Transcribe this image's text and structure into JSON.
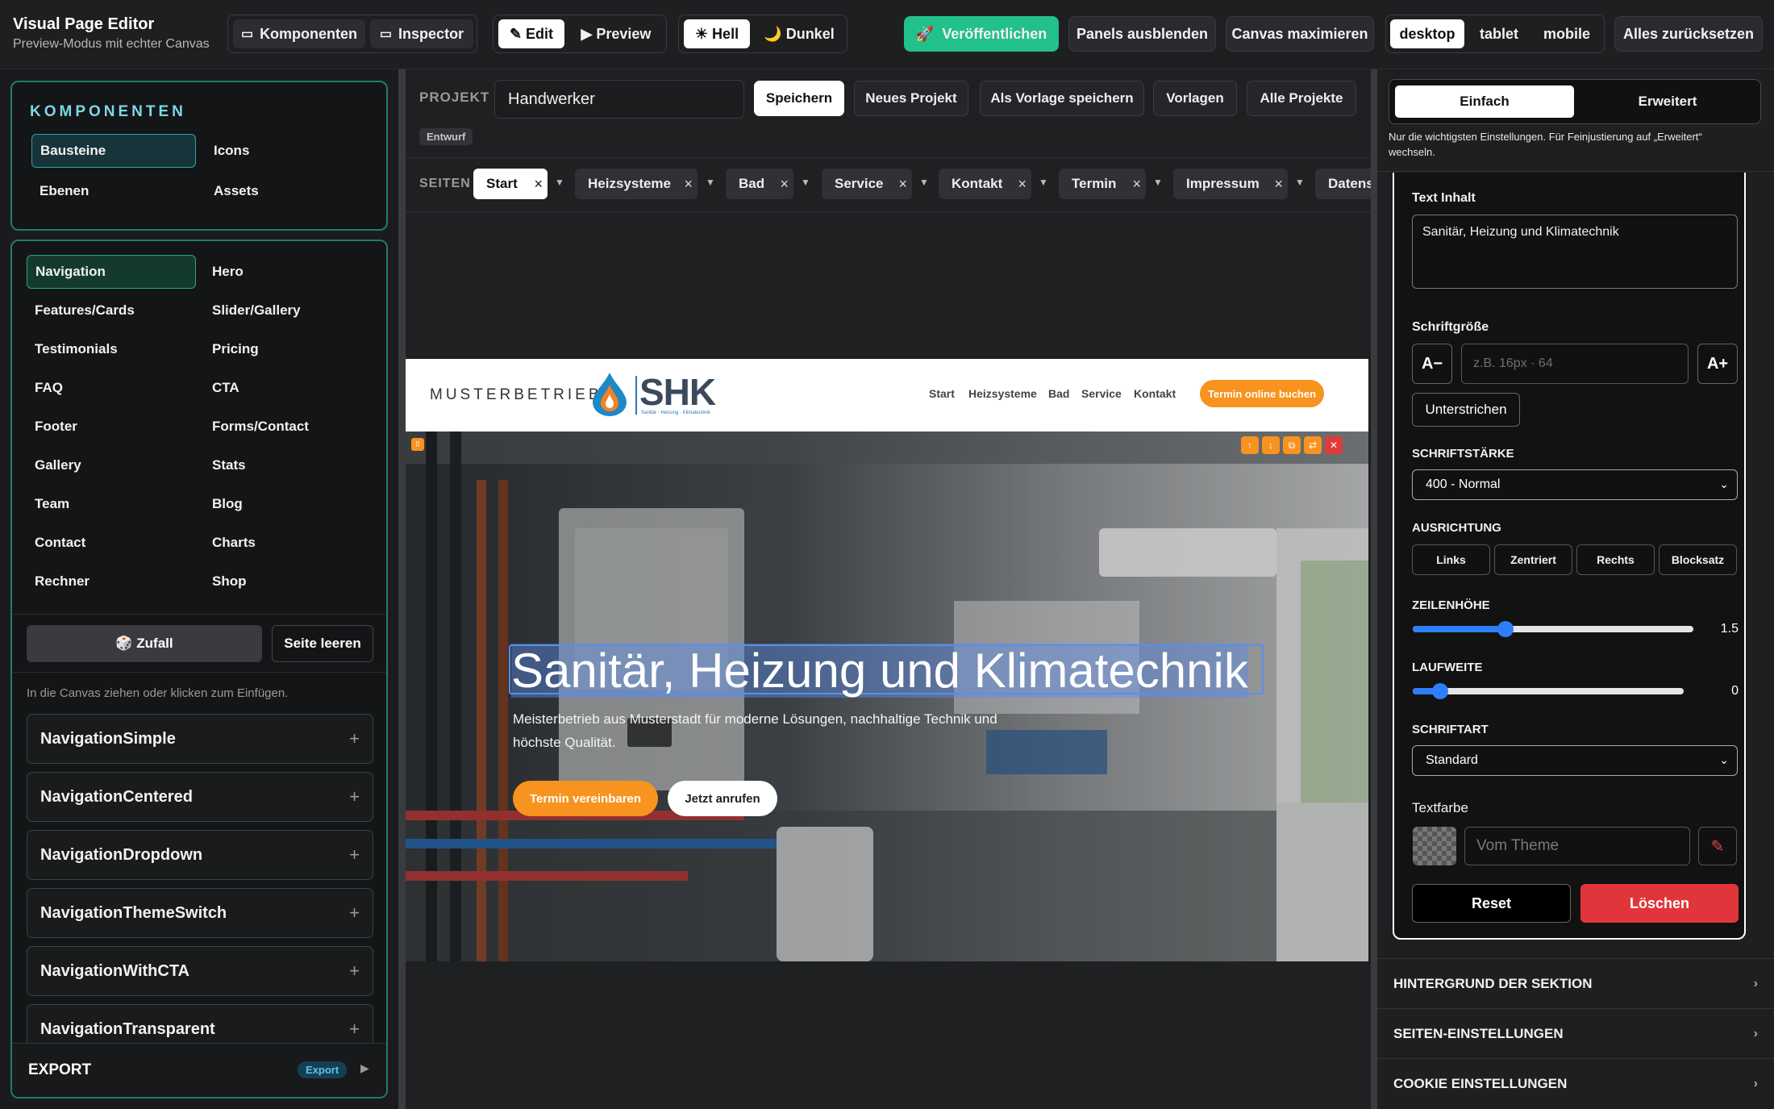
{
  "topbar": {
    "title": "Visual Page Editor",
    "subtitle": "Preview-Modus mit echter Canvas",
    "panels": {
      "komponenten": "Komponenten",
      "inspector": "Inspector"
    },
    "mode": {
      "edit": "✎ Edit",
      "preview": "▶ Preview"
    },
    "theme": {
      "light": "☀ Hell",
      "dark": "🌙 Dunkel"
    },
    "publish": "Veröffentlichen",
    "hide_panels": "Panels ausblenden",
    "maximize": "Canvas maximieren",
    "devices": [
      "desktop",
      "tablet",
      "mobile"
    ],
    "reset_all": "Alles zurücksetzen"
  },
  "left": {
    "header": "KOMPONENTEN",
    "tabs": [
      "Bausteine",
      "Icons",
      "Ebenen",
      "Assets"
    ],
    "categories": [
      "Navigation",
      "Hero",
      "Features/Cards",
      "Slider/Gallery",
      "Testimonials",
      "Pricing",
      "FAQ",
      "CTA",
      "Footer",
      "Forms/Contact",
      "Gallery",
      "Stats",
      "Team",
      "Blog",
      "Contact",
      "Charts",
      "Rechner",
      "Shop"
    ],
    "random": "🎲 Zufall",
    "clear": "Seite leeren",
    "hint": "In die Canvas ziehen oder klicken zum Einfügen.",
    "components": [
      "NavigationSimple",
      "NavigationCentered",
      "NavigationDropdown",
      "NavigationThemeSwitch",
      "NavigationWithCTA",
      "NavigationTransparent"
    ],
    "export_label": "EXPORT",
    "export_badge": "Export"
  },
  "project": {
    "label": "PROJEKT",
    "name": "Handwerker",
    "save": "Speichern",
    "new": "Neues Projekt",
    "save_template": "Als Vorlage speichern",
    "templates": "Vorlagen",
    "all": "Alle Projekte",
    "status": "Entwurf"
  },
  "pages": {
    "label": "SEITEN",
    "tabs": [
      "Start",
      "Heizsysteme",
      "Bad",
      "Service",
      "Kontakt",
      "Termin",
      "Impressum",
      "Datens"
    ]
  },
  "site": {
    "brand": "MUSTERBETRIEB",
    "logo_text": "SHK",
    "logo_sub": "Sanitär · Heizung · Klimatechnik",
    "nav": [
      "Start",
      "Heizsysteme",
      "Bad",
      "Service",
      "Kontakt"
    ],
    "nav_cta": "Termin online buchen",
    "hero_title": "Sanitär, Heizung und Klimatechnik",
    "hero_text": "Meisterbetrieb aus Musterstadt für moderne Lösungen, nachhaltige Technik und höchste Qualität.",
    "cta_primary": "Termin vereinbaren",
    "cta_secondary": "Jetzt anrufen",
    "colors": {
      "accent": "#f7931e"
    }
  },
  "inspector": {
    "tabs": [
      "Einfach",
      "Erweitert"
    ],
    "hint": "Nur die wichtigsten Einstellungen. Für Feinjustierung auf „Erweitert“ wechseln.",
    "text_label": "Text Inhalt",
    "text_value": "Sanitär, Heizung und Klimatechnik",
    "size_label": "Schriftgröße",
    "size_minus": "A−",
    "size_placeholder": "z.B. 16px · 64",
    "size_plus": "A+",
    "underline": "Unterstrichen",
    "weight_label": "SCHRIFTSTÄRKE",
    "weight_value": "400 - Normal",
    "align_label": "AUSRICHTUNG",
    "align": [
      "Links",
      "Zentriert",
      "Rechts",
      "Blocksatz"
    ],
    "lineheight_label": "ZEILENHÖHE",
    "lineheight_value": "1.5",
    "lineheight_fraction": 0.33,
    "spacing_label": "LAUFWEITE",
    "spacing_value": "0",
    "spacing_fraction": 0.1,
    "font_label": "SCHRIFTART",
    "font_value": "Standard",
    "color_label": "Textfarbe",
    "color_placeholder": "Vom Theme",
    "reset": "Reset",
    "delete": "Löschen",
    "sections": [
      "HINTERGRUND DER SEKTION",
      "SEITEN-EINSTELLUNGEN",
      "COOKIE EINSTELLUNGEN"
    ]
  }
}
